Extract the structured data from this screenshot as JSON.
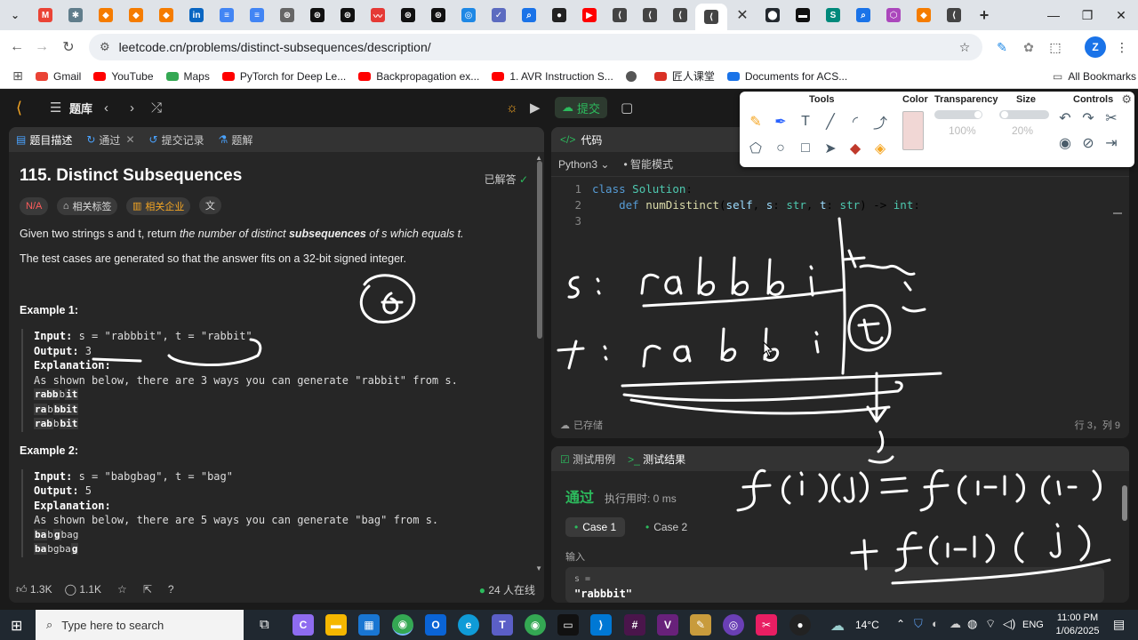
{
  "browser": {
    "url": "leetcode.cn/problems/distinct-subsequences/description/",
    "bookmarks": [
      {
        "label": "Gmail",
        "color": "#ea4335"
      },
      {
        "label": "YouTube",
        "color": "#ff0000"
      },
      {
        "label": "Maps",
        "color": "#34a853"
      },
      {
        "label": "PyTorch for Deep Le...",
        "color": "#ff0000"
      },
      {
        "label": "Backpropagation ex...",
        "color": "#ff0000"
      },
      {
        "label": "1. AVR Instruction S...",
        "color": "#ff0000"
      },
      {
        "label": "",
        "color": "#555555"
      },
      {
        "label": "匠人课堂",
        "color": "#d93025"
      },
      {
        "label": "Documents for ACS...",
        "color": "#1a73e8"
      }
    ],
    "all_bookmarks": "All Bookmarks",
    "profile_initial": "Z"
  },
  "leetcode": {
    "nav_label": "题库",
    "submit_label": "提交",
    "left_tabs": {
      "description": "题目描述",
      "passed": "通过",
      "submissions": "提交记录",
      "solutions": "题解"
    },
    "problem": {
      "title": "115. Distinct Subsequences",
      "status": "已解答",
      "difficulty": "N/A",
      "tag_topics": "相关标签",
      "tag_companies": "相关企业",
      "statement_prefix": "Given two strings s and t, return ",
      "statement_italic_1": "the number of distinct ",
      "statement_bold": "subsequences",
      "statement_italic_2": " of s which equals t.",
      "note": "The test cases are generated so that the answer fits on a 32-bit signed integer.",
      "example1": {
        "heading": "Example 1:",
        "input_label": "Input:",
        "input_value": " s = \"rabbbit\", t = \"rabbit\"",
        "output_label": "Output:",
        "output_value": " 3",
        "explanation_label": "Explanation:",
        "explanation_text": "As shown below, there are 3 ways you can generate \"rabbit\" from s."
      },
      "example2": {
        "heading": "Example 2:",
        "input_label": "Input:",
        "input_value": " s = \"babgbag\", t = \"bag\"",
        "output_label": "Output:",
        "output_value": " 5",
        "explanation_label": "Explanation:",
        "explanation_text": "As shown below, there are 5 ways you can generate \"bag\" from s."
      }
    },
    "footer": {
      "likes": "1.3K",
      "comments": "1.1K",
      "online": "24 人在线"
    },
    "code": {
      "header": "代码",
      "language": "Python3",
      "mode": "智能模式",
      "lines": [
        {
          "n": "1",
          "text": "class Solution:"
        },
        {
          "n": "2",
          "text": "    def numDistinct(self, s: str, t: str) -> int:"
        },
        {
          "n": "3",
          "text": ""
        }
      ],
      "saved": "已存储",
      "cursor": "行 3，列 9"
    },
    "tests": {
      "tab_cases": "测试用例",
      "tab_results": "测试结果",
      "verdict": "通过",
      "runtime": "执行用时: 0 ms",
      "case1": "Case 1",
      "case2": "Case 2",
      "input_label": "输入",
      "s_label": "s =",
      "s_value": "\"rabbbit\""
    }
  },
  "tools_overlay": {
    "tools": "Tools",
    "color": "Color",
    "transparency": "Transparency",
    "transparency_value": "100%",
    "size": "Size",
    "size_value": "20%",
    "controls": "Controls"
  },
  "taskbar": {
    "search_placeholder": "Type here to search",
    "weather": "14°C",
    "language": "ENG",
    "time": "11:00 PM",
    "date": "1/06/2025"
  }
}
